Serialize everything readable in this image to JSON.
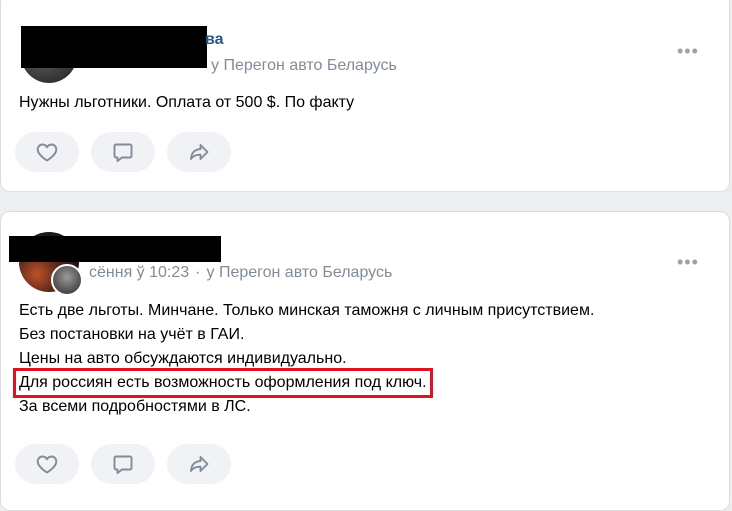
{
  "posts": [
    {
      "author_tail": "ва",
      "meta": "у Перегон авто Беларусь",
      "text_lines": [
        "Нужны льготники. Оплата от 500 $. По факту"
      ],
      "more": "•••"
    },
    {
      "time": "сёння ў 10:23",
      "separator": "·",
      "meta": "у Перегон авто Беларусь",
      "text_lines": [
        "Есть две льготы. Минчане. Только минская таможня с личным присутствием.",
        "Без постановки на учёт в ГАИ.",
        "Цены на авто обсуждаются индивидуально.",
        "Для россиян есть возможность оформления под ключ.",
        "За всеми подробностями в ЛС."
      ],
      "highlighted_line_index": 3,
      "more": "•••"
    }
  ],
  "actions": {
    "like_icon": "heart-icon",
    "comment_icon": "comment-icon",
    "share_icon": "share-icon"
  },
  "colors": {
    "background": "#edeef0",
    "card": "#ffffff",
    "link": "#2a5885",
    "meta": "#818c99",
    "highlight_border": "#e0121f",
    "icon": "#99a2ad"
  }
}
